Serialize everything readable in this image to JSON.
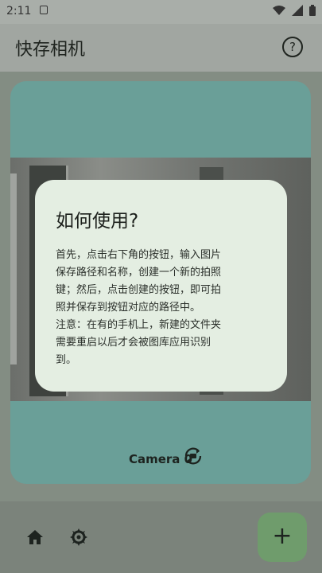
{
  "status_bar": {
    "time": "2:11"
  },
  "app_bar": {
    "title": "快存相机"
  },
  "camera": {
    "label": "Camera 0"
  },
  "dialog": {
    "title": "如何使用?",
    "body": "首先，点击右下角的按钮，输入图片\n保存路径和名称，创建一个新的拍照\n键；然后，点击创建的按钮，即可拍\n照并保存到按钮对应的路径中。\n注意：在有的手机上，新建的文件夹\n需要重启以后才会被图库应用识别\n到。"
  },
  "bottom_bar": {
    "fab_symbol": "+"
  },
  "icons": [
    "notification-icon",
    "wifi-icon",
    "signal-icon",
    "battery-icon",
    "help-icon",
    "camera-switch-icon",
    "home-icon",
    "gear-icon"
  ]
}
